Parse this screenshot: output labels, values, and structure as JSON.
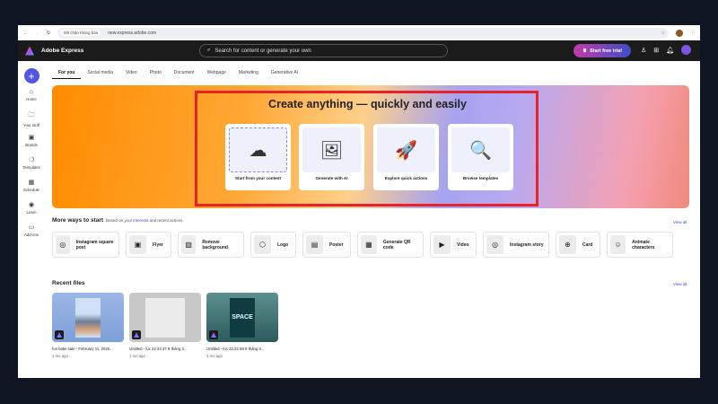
{
  "browser": {
    "site_chip": "Đã chặn thông báo",
    "url": "new.express.adobe.com"
  },
  "app": {
    "name": "Adobe Express",
    "search_placeholder": "Search for content or generate your own",
    "trial_label": "Start free trial"
  },
  "sidebar": {
    "items": [
      {
        "label": "Home",
        "icon": "⌂"
      },
      {
        "label": "Your stuff",
        "icon": "🗀"
      },
      {
        "label": "Brands",
        "icon": "▣"
      },
      {
        "label": "Templates",
        "icon": "❍"
      },
      {
        "label": "Schedule",
        "icon": "▦"
      },
      {
        "label": "Learn",
        "icon": "◉"
      },
      {
        "label": "Add-ons",
        "icon": "▭"
      }
    ]
  },
  "tabs": [
    "For you",
    "Social media",
    "Video",
    "Photo",
    "Document",
    "Webpage",
    "Marketing",
    "Generative AI"
  ],
  "hero": {
    "title": "Create anything — quickly and easily",
    "cards": [
      {
        "label": "Start from your content",
        "icon": "☁"
      },
      {
        "label": "Generate with AI",
        "icon": "🖼"
      },
      {
        "label": "Explore quick actions",
        "icon": "🚀"
      },
      {
        "label": "Browse templates",
        "icon": "🔍"
      }
    ]
  },
  "more": {
    "title": "More ways to start",
    "subtitle_pre": "Based on your",
    "subtitle_link": "interests",
    "subtitle_post": "and recent actions.",
    "view_all": "View all",
    "items": [
      {
        "label": "Instagram square post",
        "icon": "◎"
      },
      {
        "label": "Flyer",
        "icon": "▣"
      },
      {
        "label": "Remove background",
        "icon": "▨"
      },
      {
        "label": "Logo",
        "icon": "⬡"
      },
      {
        "label": "Poster",
        "icon": "▤"
      },
      {
        "label": "Generate QR code",
        "icon": "▦"
      },
      {
        "label": "Video",
        "icon": "▶"
      },
      {
        "label": "Instagram story",
        "icon": "◎"
      },
      {
        "label": "Card",
        "icon": "⊕"
      },
      {
        "label": "Animate characters",
        "icon": "☺"
      }
    ]
  },
  "recent": {
    "title": "Recent files",
    "view_all": "View all",
    "files": [
      {
        "name": "fun bake sale - February 11, 2025...",
        "time": "1 mo ago"
      },
      {
        "name": "Untitled - lúc 22.24.37 8 tháng 3...",
        "time": "1 mo ago"
      },
      {
        "name": "Untitled - lúc 22.22.58 8 tháng 3...",
        "time": "1 mo ago"
      }
    ],
    "space_text": "SPACE"
  }
}
